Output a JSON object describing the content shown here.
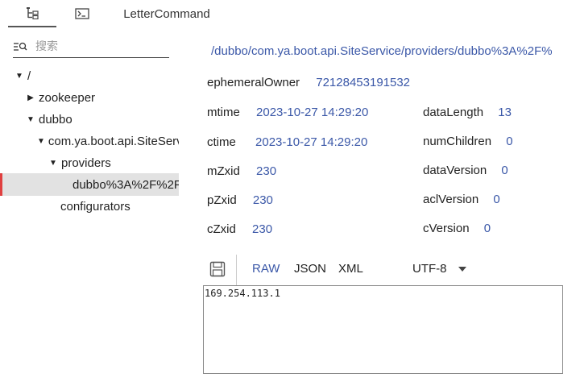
{
  "tabs": {
    "tree_icon": "tree-icon",
    "terminal_icon": "terminal-icon",
    "letter_command": "LetterCommand"
  },
  "sidebar": {
    "search_placeholder": "搜索",
    "tree": [
      {
        "label": "/",
        "expanded": true,
        "level": 0
      },
      {
        "label": "zookeeper",
        "expanded": false,
        "level": 1
      },
      {
        "label": "dubbo",
        "expanded": true,
        "level": 1
      },
      {
        "label": "com.ya.boot.api.SiteServ",
        "expanded": true,
        "level": 2
      },
      {
        "label": "providers",
        "expanded": true,
        "level": 3
      },
      {
        "label": "dubbo%3A%2F%2F",
        "selected": true,
        "level": 4
      },
      {
        "label": "configurators",
        "level": 3
      }
    ]
  },
  "detail": {
    "path": "/dubbo/com.ya.boot.api.SiteService/providers/dubbo%3A%2F%",
    "ephemeralOwner": {
      "label": "ephemeralOwner",
      "value": "72128453191532"
    },
    "mtime": {
      "label": "mtime",
      "value": "2023-10-27 14:29:20"
    },
    "ctime": {
      "label": "ctime",
      "value": "2023-10-27 14:29:20"
    },
    "mZxid": {
      "label": "mZxid",
      "value": "230"
    },
    "pZxid": {
      "label": "pZxid",
      "value": "230"
    },
    "cZxid": {
      "label": "cZxid",
      "value": "230"
    },
    "dataLength": {
      "label": "dataLength",
      "value": "13"
    },
    "numChildren": {
      "label": "numChildren",
      "value": "0"
    },
    "dataVersion": {
      "label": "dataVersion",
      "value": "0"
    },
    "aclVersion": {
      "label": "aclVersion",
      "value": "0"
    },
    "cVersion": {
      "label": "cVersion",
      "value": "0"
    }
  },
  "toolbar": {
    "raw": "RAW",
    "json": "JSON",
    "xml": "XML",
    "encoding": "UTF-8"
  },
  "editor": {
    "content": "169.254.113.1"
  },
  "colors": {
    "accent": "#3b58a8",
    "selected_marker": "#e04040",
    "selected_bg": "#e2e2e2"
  }
}
